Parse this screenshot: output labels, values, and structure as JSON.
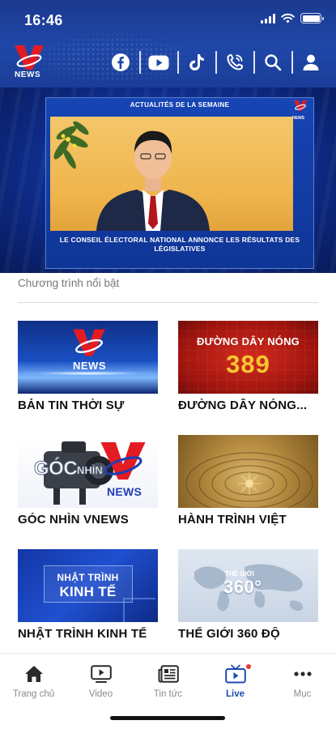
{
  "status_bar": {
    "time": "16:46"
  },
  "header": {
    "logo_text": "NEWS",
    "icons": [
      "facebook-icon",
      "youtube-icon",
      "tiktok-icon",
      "phone-icon",
      "search-icon",
      "user-icon"
    ]
  },
  "featured": {
    "top_caption": "ACTUALITÉS DE LA SEMAINE",
    "mini_logo_text": "NEWS",
    "bottom_caption": "LE CONSEIL ÉLECTORAL NATIONAL ANNONCE LES RÉSULTATS DES LÉGISLATIVES"
  },
  "section": {
    "title": "Chương trình nổi bật"
  },
  "programs": [
    {
      "title": "BẢN TIN THỜI SỰ",
      "thumb_text": "NEWS"
    },
    {
      "title": "ĐƯỜNG DÂY NÓNG...",
      "thumb_line1": "ĐƯỜNG DÂY NÓNG",
      "thumb_line2": "389"
    },
    {
      "title": "GÓC NHÌN VNEWS",
      "thumb_text1": "GÓC",
      "thumb_text2": "NHÌN",
      "thumb_text3": "NEWS"
    },
    {
      "title": "HÀNH TRÌNH VIỆT"
    },
    {
      "title": "NHẬT TRÌNH KINH TẾ",
      "thumb_line1": "NHẬT TRÌNH",
      "thumb_line2": "KINH TẾ"
    },
    {
      "title": "THẾ GIỚI 360 ĐỘ",
      "thumb_line1": "THẾ GIỚI",
      "thumb_line2": "360°"
    }
  ],
  "bottom_nav": {
    "items": [
      {
        "label": "Trang chủ",
        "icon": "home-icon"
      },
      {
        "label": "Video",
        "icon": "video-icon"
      },
      {
        "label": "Tin tức",
        "icon": "news-icon"
      },
      {
        "label": "Live",
        "icon": "live-tv-icon",
        "active": true
      },
      {
        "label": "Mục",
        "icon": "more-icon"
      }
    ]
  },
  "colors": {
    "brand_blue": "#1f47a8",
    "accent_red": "#e31b23",
    "active_nav": "#1f4bb0"
  }
}
